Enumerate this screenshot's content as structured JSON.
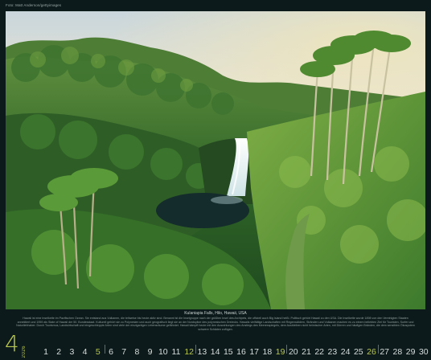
{
  "photo_credit": "Foto: Matt Anderson/gettyimages",
  "caption": {
    "title": "Kulaniapia Falls, Hilo, Hawaii, USA",
    "body": "Hawaii ist eine Inselkette im Pazifischen Ozean. Sie entstand aus Vulkanen, die teilweise bis heute aktiv sind. Benannt ist die Inselgruppe nach der größten Insel des Archipels, die offiziell auch Big Island heißt. Politisch gehört Hawaii zu den USA. Die Inselkette wurde 1898 von den Vereinigten Staaten annektiert und 1959 als State of Hawaii der 50. Bundesstaat. Kulturell gehört sie zu Polynesien und auch geografisch liegt sie an der Nordspitze des polynesischen Dreiecks. Hawaiis vielfältige Landschaften mit Regenwäldern, Stränden und Vulkanen machen es zu einem beliebten Ziel für Touristen, Surfer und Naturliebhaber. Durch Tourismus, Landwirtschaft und eingeschleppte Arten sind viele der einzigartigen Lebensräume gefährdet. Hawaii kämpft heute mit den Auswirkungen des Anstiegs des Meeresspiegels, dem Ausbleiben nicht heimischer Arten, mit Dürren und häufigen Bränden, die dem sensiblen Ökosystem schwere Schäden zufügen."
  },
  "calendar": {
    "month_number": "4",
    "year": "2026",
    "days": [
      "1",
      "2",
      "3",
      "4",
      "5",
      "6",
      "7",
      "8",
      "9",
      "10",
      "11",
      "12",
      "13",
      "14",
      "15",
      "16",
      "17",
      "18",
      "19",
      "20",
      "21",
      "22",
      "23",
      "24",
      "25",
      "26",
      "27",
      "28",
      "29",
      "30"
    ],
    "sundays": [
      "5",
      "12",
      "19",
      "26"
    ],
    "highlight_color": "#b9c84e"
  }
}
